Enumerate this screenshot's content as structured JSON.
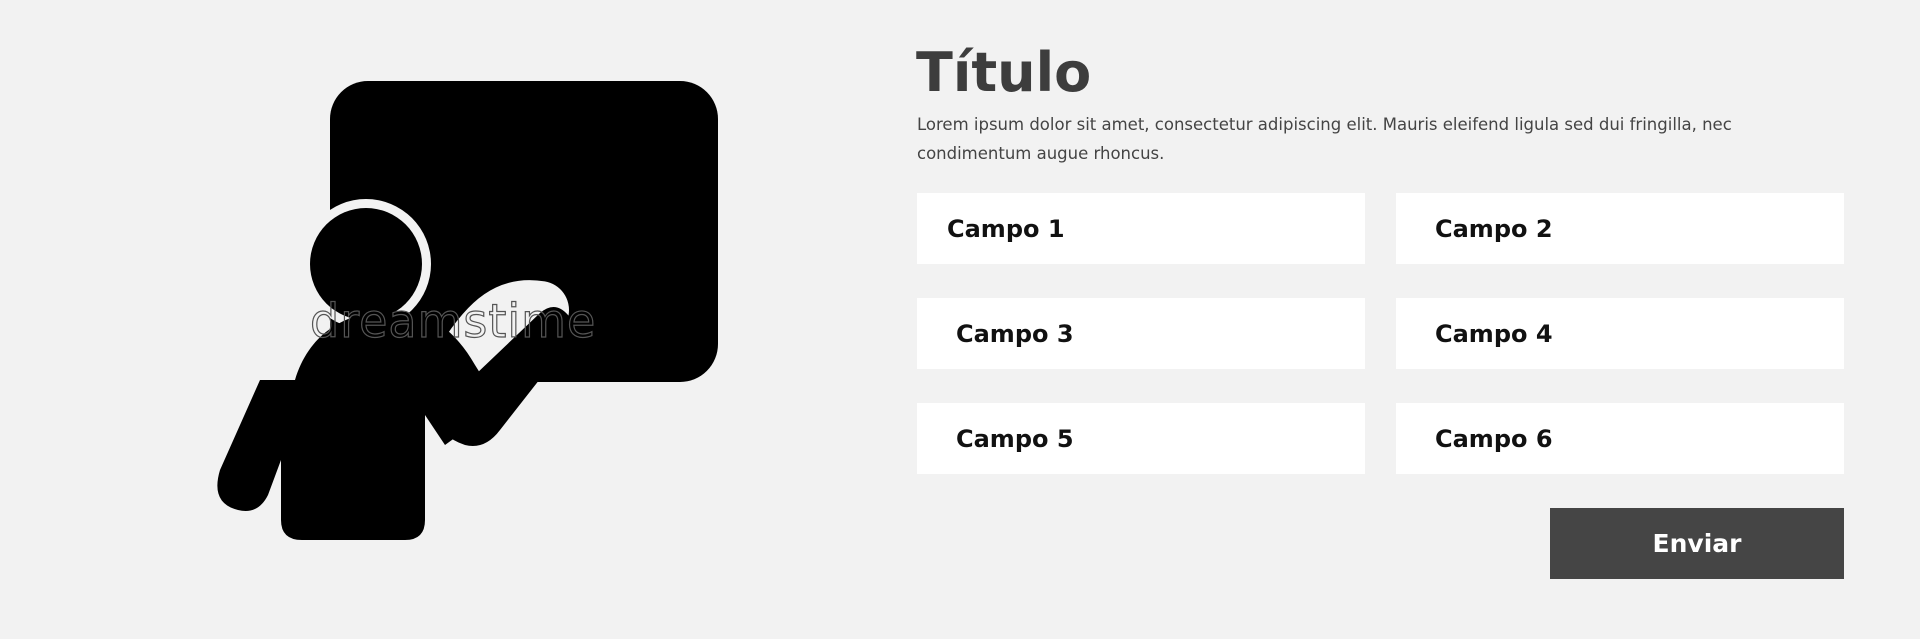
{
  "illustration": {
    "watermark_text": "dreamstime",
    "icon": "teacher-at-blackboard-icon"
  },
  "form": {
    "title": "Título",
    "description": "Lorem ipsum dolor sit amet, consectetur adipiscing elit. Mauris eleifend ligula sed dui fringilla, nec condimentum augue rhoncus.",
    "fields": [
      {
        "placeholder": "Campo 1"
      },
      {
        "placeholder": "Campo 2"
      },
      {
        "placeholder": "Campo 3"
      },
      {
        "placeholder": "Campo 4"
      },
      {
        "placeholder": "Campo 5"
      },
      {
        "placeholder": "Campo 6"
      }
    ],
    "submit_label": "Enviar"
  },
  "colors": {
    "background": "#f2f2f2",
    "field_background": "#ffffff",
    "button_background": "#454545",
    "title_color": "#3d3d3d",
    "icon_color": "#000000"
  }
}
